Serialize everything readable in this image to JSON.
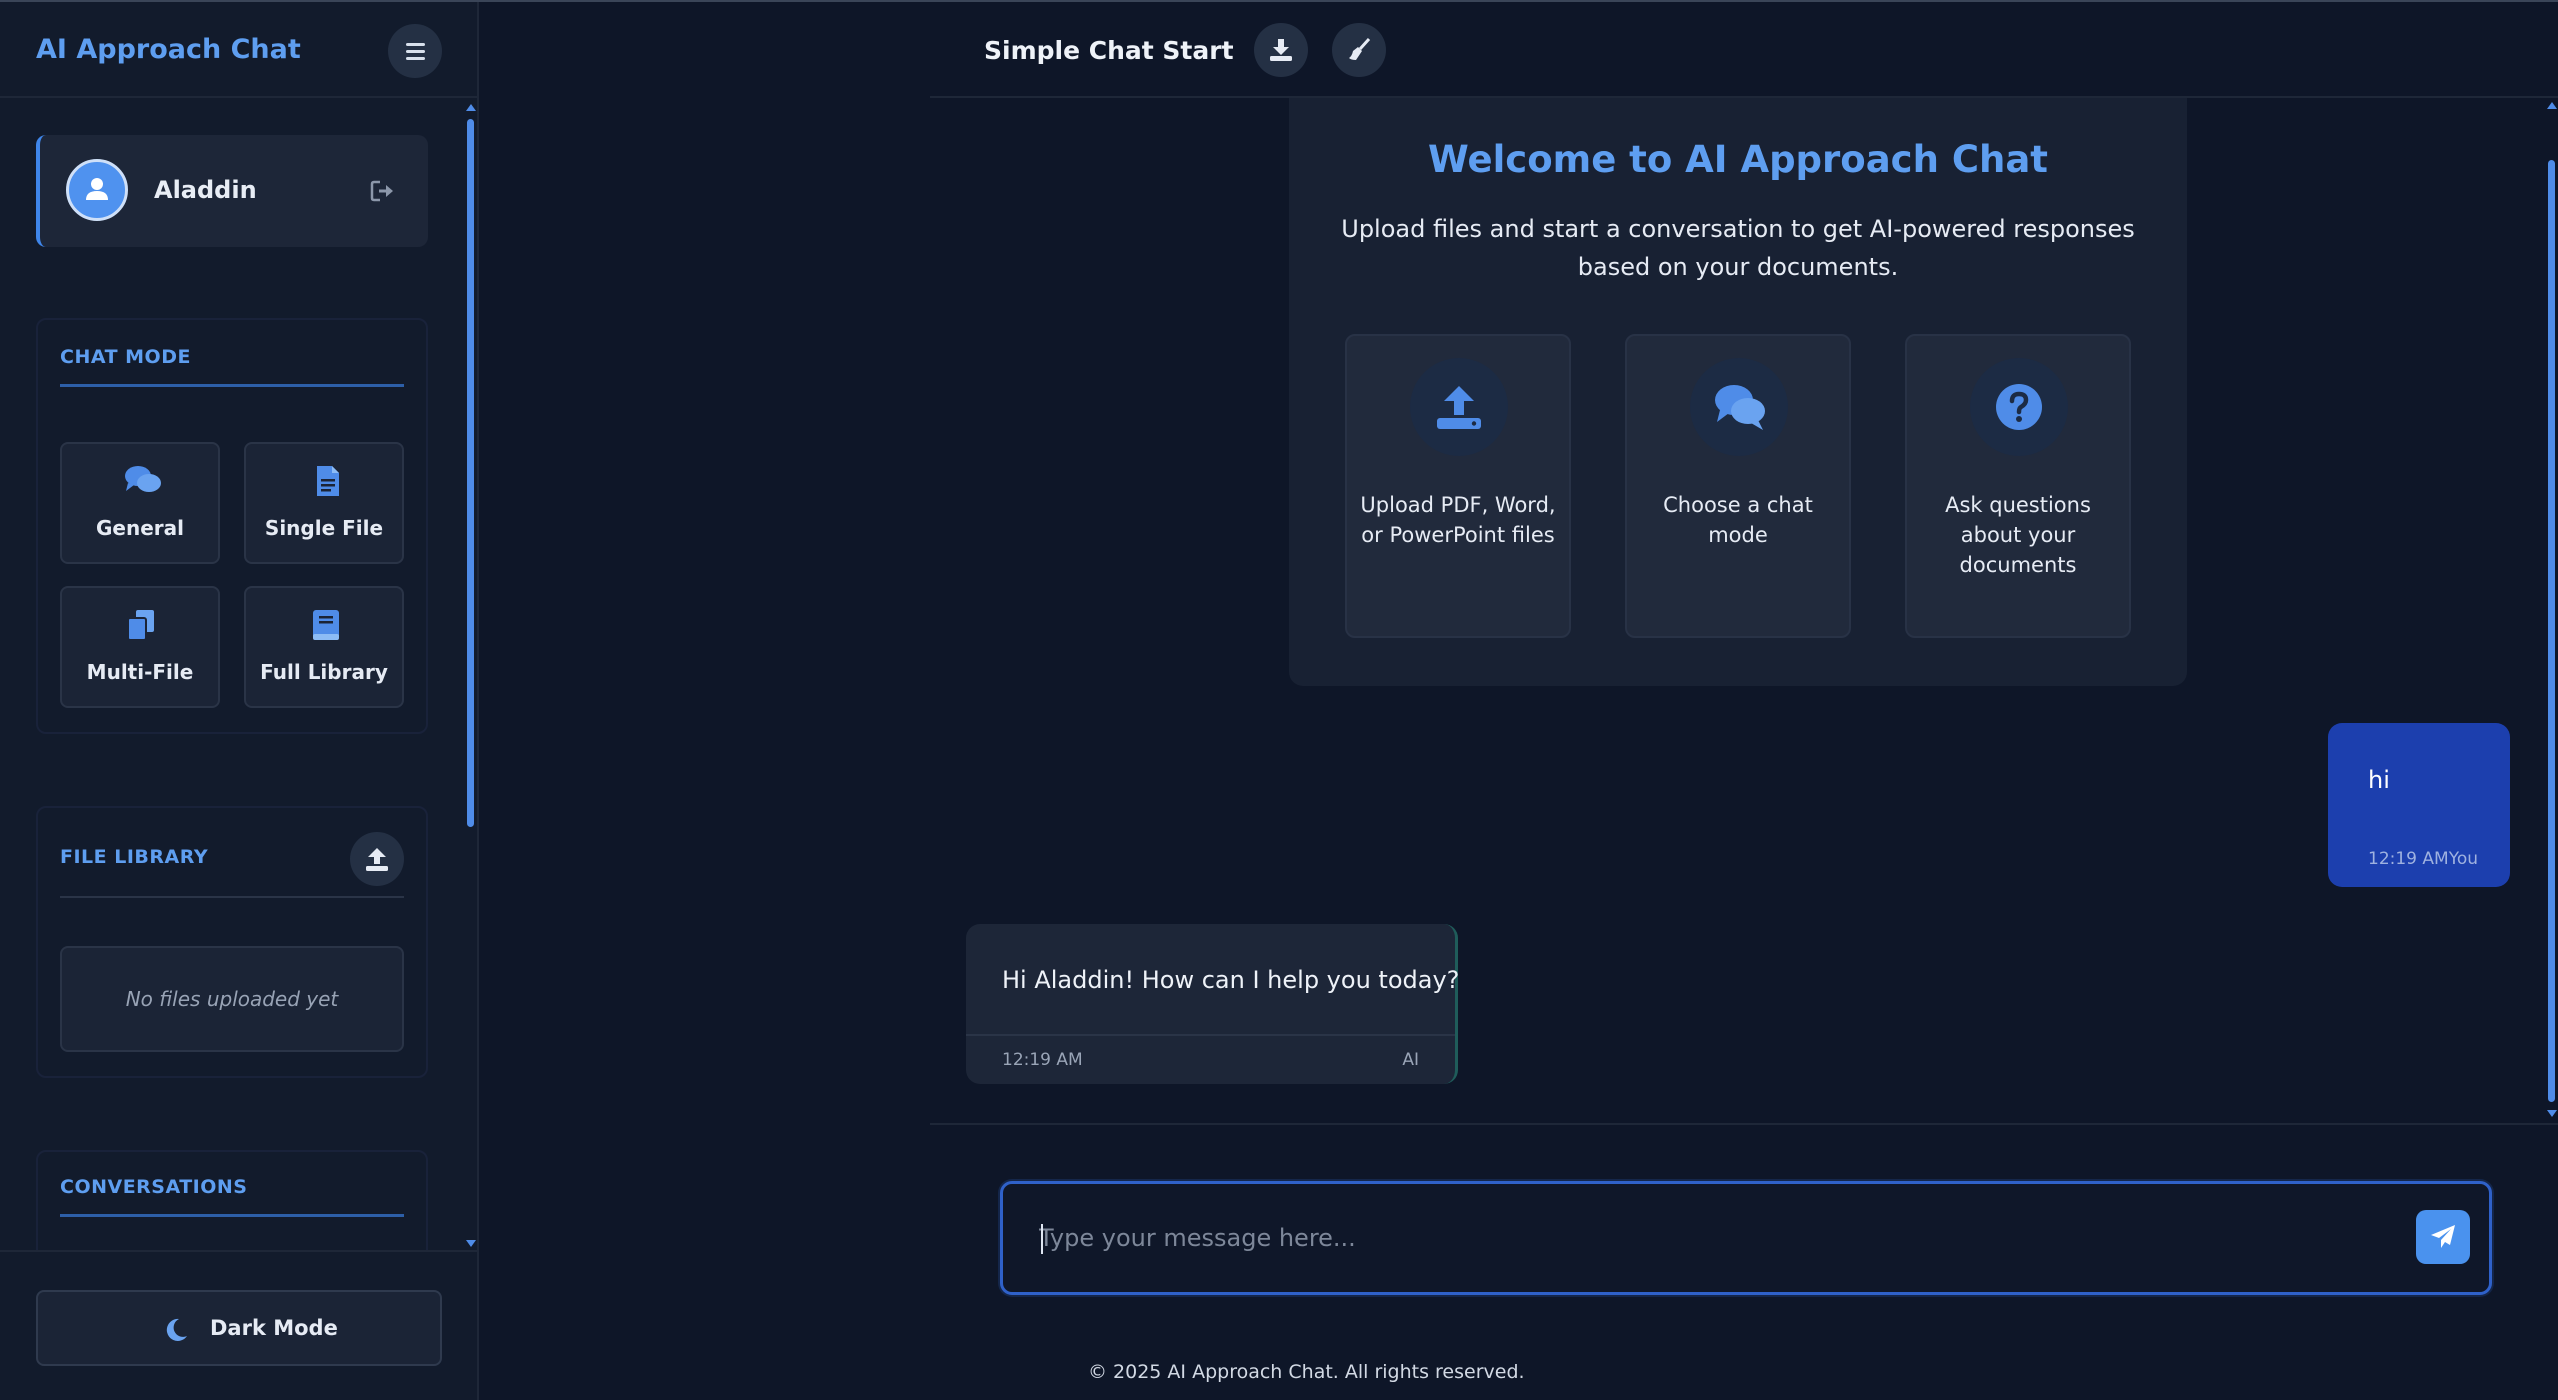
{
  "sidebar": {
    "app_title": "AI Approach Chat",
    "user": {
      "name": "Aladdin"
    },
    "chat_mode": {
      "title": "CHAT MODE",
      "modes": [
        {
          "label": "General",
          "icon": "comments-icon"
        },
        {
          "label": "Single File",
          "icon": "file-icon"
        },
        {
          "label": "Multi-File",
          "icon": "copy-files-icon"
        },
        {
          "label": "Full Library",
          "icon": "book-icon"
        }
      ]
    },
    "file_library": {
      "title": "FILE LIBRARY",
      "empty_text": "No files uploaded yet"
    },
    "conversations": {
      "title": "CONVERSATIONS"
    },
    "dark_mode_label": "Dark Mode"
  },
  "header": {
    "chat_title": "Simple Chat Start"
  },
  "welcome": {
    "title": "Welcome to AI Approach Chat",
    "subtitle": "Upload files and start a conversation to get AI-powered responses based on your documents.",
    "features": [
      {
        "text": "Upload PDF, Word, or PowerPoint files",
        "icon": "upload-icon"
      },
      {
        "text": "Choose a chat mode",
        "icon": "comments-icon"
      },
      {
        "text": "Ask questions about your documents",
        "icon": "question-icon"
      }
    ]
  },
  "messages": [
    {
      "sender": "You",
      "text": "hi",
      "time": "12:19 AM"
    },
    {
      "sender": "AI",
      "text": "Hi Aladdin! How can I help you today?",
      "time": "12:19 AM"
    }
  ],
  "composer": {
    "placeholder": "Type your message here..."
  },
  "footer": {
    "copyright": "© 2025 AI Approach Chat. All rights reserved."
  },
  "colors": {
    "accent": "#5e9ef0",
    "user_bubble": "#1c3fae",
    "background": "#0e1628"
  }
}
